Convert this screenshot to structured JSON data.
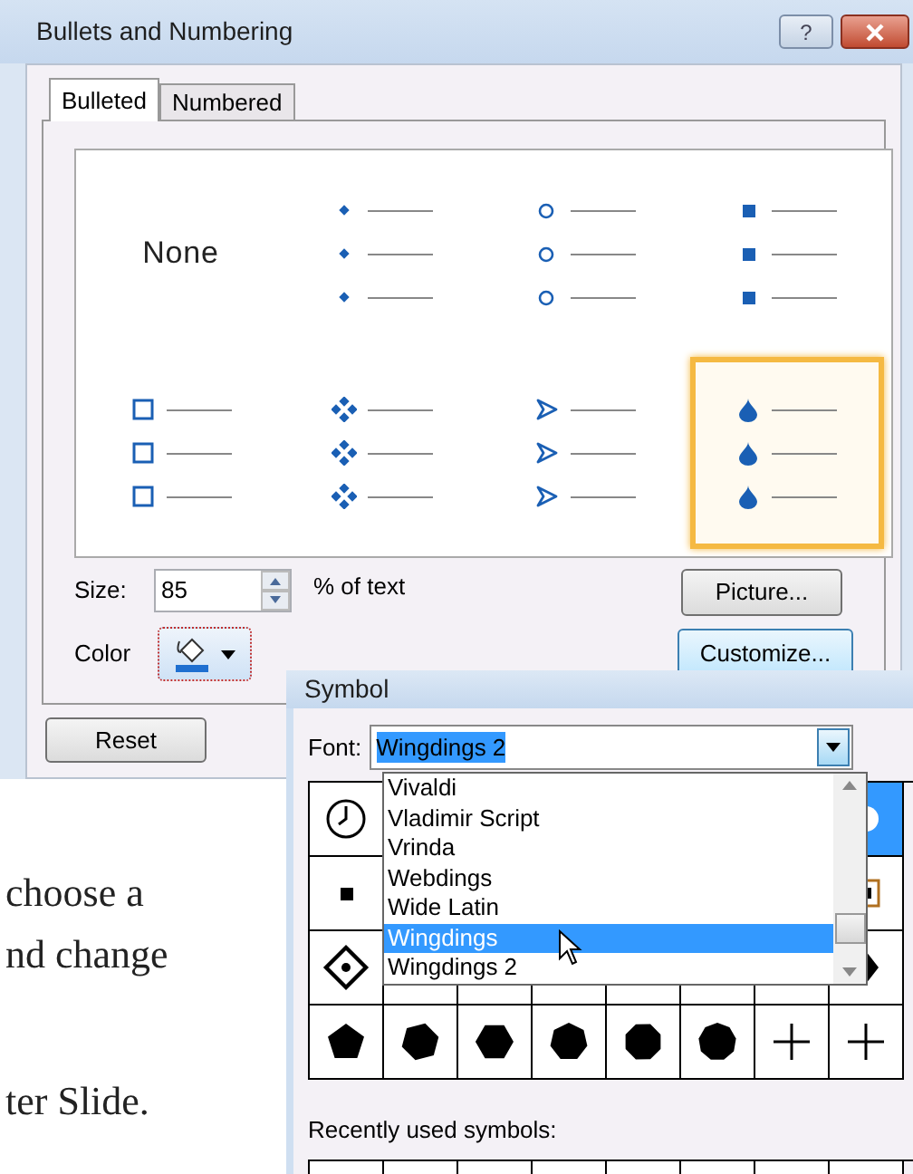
{
  "window": {
    "title": "Bullets and Numbering",
    "help_button": "?"
  },
  "tabs": [
    {
      "label": "Bulleted",
      "selected": true
    },
    {
      "label": "Numbered",
      "selected": false
    }
  ],
  "bullet_styles": [
    {
      "kind": "none",
      "label": "None",
      "selected": false
    },
    {
      "kind": "dot",
      "selected": false
    },
    {
      "kind": "hollow-circle",
      "selected": false
    },
    {
      "kind": "square",
      "selected": false
    },
    {
      "kind": "hollow-square",
      "selected": false
    },
    {
      "kind": "diamond-cluster",
      "selected": false
    },
    {
      "kind": "arrowhead",
      "selected": false
    },
    {
      "kind": "drop",
      "selected": true
    }
  ],
  "size": {
    "label": "Size:",
    "value": "85",
    "unit": "% of text"
  },
  "color": {
    "label": "Color"
  },
  "buttons": {
    "picture": "Picture...",
    "customize": "Customize...",
    "reset": "Reset"
  },
  "document": {
    "lines": [
      "choose a",
      "nd change",
      "ter Slide."
    ]
  },
  "symbol_dialog": {
    "title": "Symbol",
    "font_label": "Font:",
    "font_value": "Wingdings 2",
    "font_options": [
      {
        "label": "Vivaldi",
        "selected": false
      },
      {
        "label": "Vladimir Script",
        "selected": false
      },
      {
        "label": "Vrinda",
        "selected": false
      },
      {
        "label": "Webdings",
        "selected": false
      },
      {
        "label": "Wide Latin",
        "selected": false
      },
      {
        "label": "Wingdings",
        "selected": true
      },
      {
        "label": "Wingdings 2",
        "selected": false
      }
    ],
    "symbol_rows": [
      {
        "cells": [
          {
            "kind": "clock",
            "selected": false
          },
          {
            "kind": "circle",
            "selected": true
          }
        ]
      },
      {
        "cells": [
          {
            "kind": "small-square",
            "selected": false
          },
          {
            "kind": "boxed-square",
            "selected": false
          }
        ]
      },
      {
        "cells": [
          {
            "kind": "dotted-diamond",
            "selected": false
          },
          {
            "kind": "diamond",
            "selected": false
          }
        ]
      },
      {
        "cells": [
          {
            "kind": "pentagon",
            "selected": false
          },
          {
            "kind": "polygon6",
            "selected": false
          },
          {
            "kind": "hexagon",
            "selected": false
          },
          {
            "kind": "heptagon",
            "selected": false
          },
          {
            "kind": "octagon",
            "selected": false
          },
          {
            "kind": "nonagon",
            "selected": false
          },
          {
            "kind": "plus",
            "selected": false
          },
          {
            "kind": "plus",
            "selected": false
          }
        ]
      }
    ],
    "recent_label": "Recently used symbols:"
  }
}
